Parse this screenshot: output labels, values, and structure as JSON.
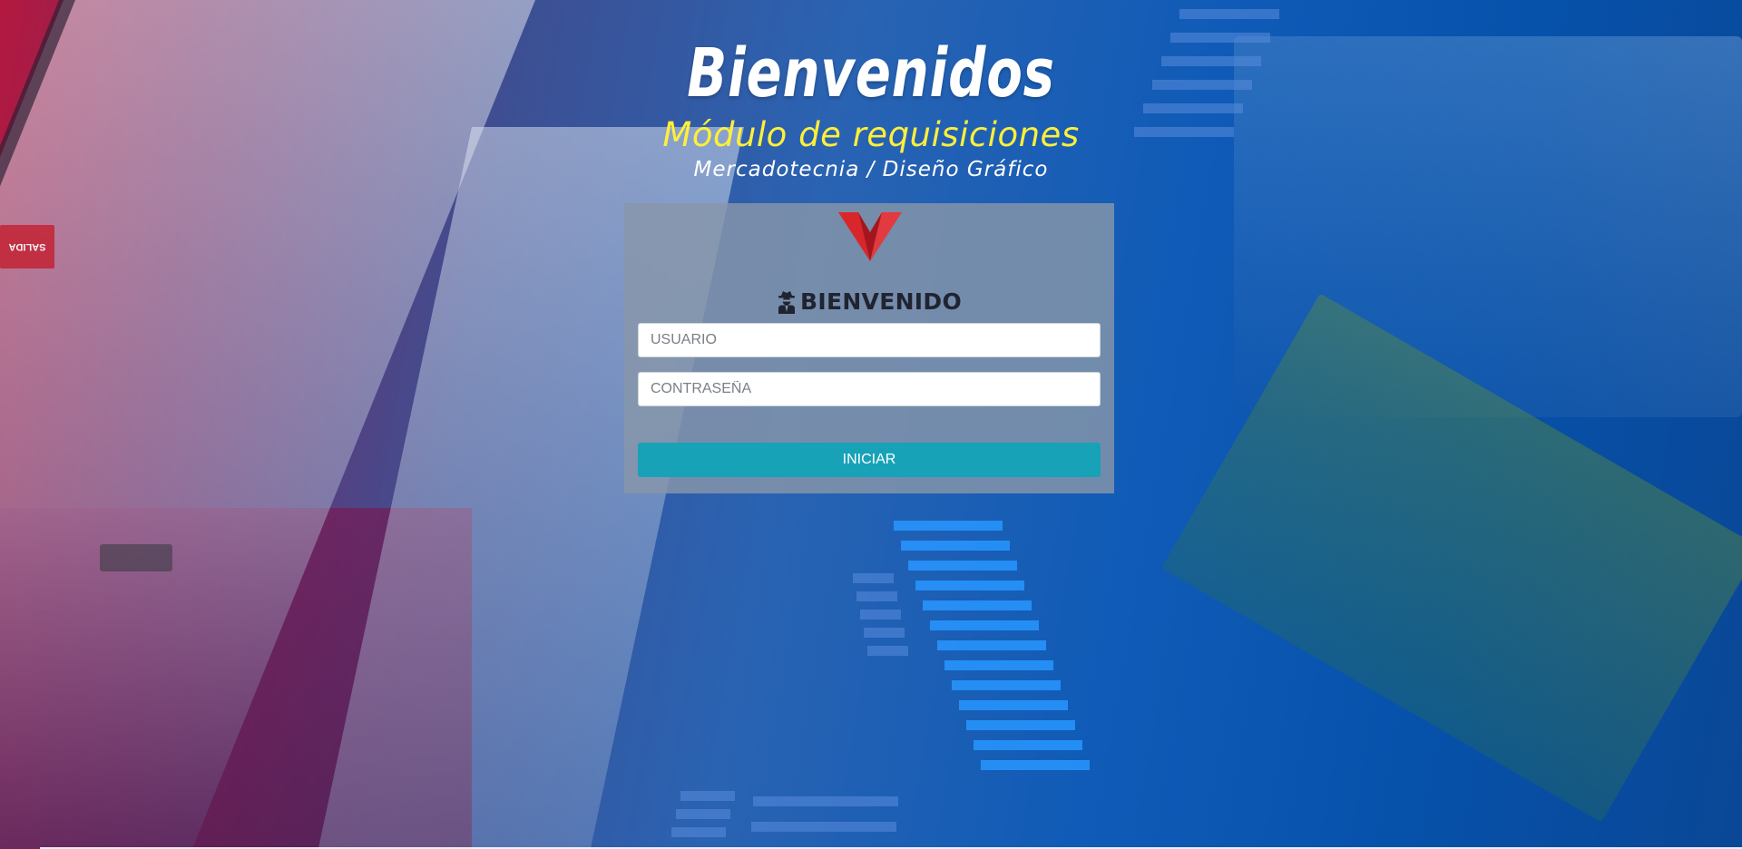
{
  "hero": {
    "title": "Bienvenidos",
    "subtitle": "Módulo de requisiciones",
    "department": "Mercadotecnia / Diseño Gráfico"
  },
  "background": {
    "exit_sign": "SALIDA"
  },
  "login": {
    "logo": "brand-logo-icon",
    "welcome_icon": "user-secret-icon",
    "welcome": "BIENVENIDO",
    "username_placeholder": "USUARIO",
    "password_placeholder": "CONTRASEÑA",
    "submit_label": "INICIAR"
  },
  "colors": {
    "subtitle": "#ffef3a",
    "button": "#17a2b8",
    "logo": "#d9262b"
  }
}
